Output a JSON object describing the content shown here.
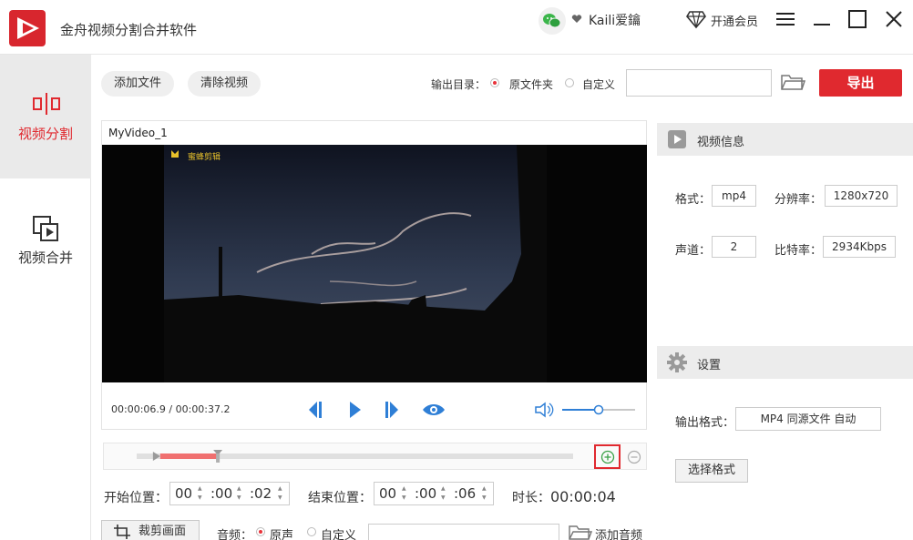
{
  "app": {
    "title": "金舟视频分割合并软件"
  },
  "header": {
    "username": "Kaili爱鑰",
    "vip_label": "开通会员"
  },
  "sidebar": {
    "items": [
      {
        "label": "视频分割",
        "active": true
      },
      {
        "label": "视频合并",
        "active": false
      }
    ]
  },
  "toolbar": {
    "add_file": "添加文件",
    "clear_video": "清除视频",
    "output_dir_label": "输出目录：",
    "option_source": "原文件夹",
    "option_custom": "自定义",
    "path_value": "",
    "export_label": "导出"
  },
  "video": {
    "title": "MyVideo_1",
    "watermark": "蜜蜂剪辑",
    "current_time": "00:00:06.9",
    "total_time": "00:00:37.2",
    "time_sep": " / ",
    "volume": 0.5
  },
  "info": {
    "header": "视频信息",
    "format_label": "格式：",
    "format_value": "mp4",
    "resolution_label": "分辨率：",
    "resolution_value": "1280x720",
    "channels_label": "声道：",
    "channels_value": "2",
    "bitrate_label": "比特率：",
    "bitrate_value": "2934Kbps"
  },
  "settings": {
    "header": "设置",
    "output_format_label": "输出格式：",
    "output_format_value": "MP4 同源文件 自动",
    "choose_format": "选择格式"
  },
  "timeline": {
    "start_label": "开始位置：",
    "start": [
      "00",
      ":00",
      ":02"
    ],
    "end_label": "结束位置：",
    "end": [
      "00",
      ":00",
      ":06"
    ],
    "duration_label": "时长：",
    "duration_value": "00:00:04",
    "selection_start": 0.054,
    "selection_end": 0.186
  },
  "bottom": {
    "crop_label": "裁剪画面",
    "audio_label": "音频：",
    "audio_original": "原声",
    "audio_custom": "自定义",
    "audio_path": "",
    "add_audio": "添加音频"
  },
  "colors": {
    "accent": "#e0292f",
    "blue": "#2f7fd6"
  }
}
